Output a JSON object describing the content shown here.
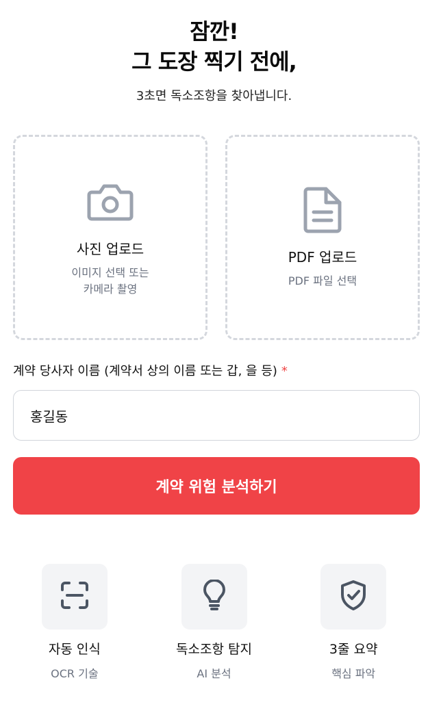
{
  "hero": {
    "title_line1": "잠깐!",
    "title_line2": "그 도장 찍기 전에,",
    "subtitle": "3초면 독소조항을 찾아냅니다."
  },
  "uploads": [
    {
      "title": "사진 업로드",
      "description": "이미지 선택 또는\n카메라 촬영",
      "icon": "camera-icon"
    },
    {
      "title": "PDF 업로드",
      "description": "PDF 파일 선택",
      "icon": "document-icon"
    }
  ],
  "form": {
    "label": "계약 당사자 이름 (계약서 상의 이름 또는 갑, 을 등)",
    "required_mark": "*",
    "name_value": "홍길동"
  },
  "analyze_button": {
    "label": "계약 위험 분석하기"
  },
  "features": [
    {
      "title": "자동 인식",
      "subtitle": "OCR 기술",
      "icon": "scan-icon"
    },
    {
      "title": "독소조항 탐지",
      "subtitle": "AI 분석",
      "icon": "lightbulb-icon"
    },
    {
      "title": "3줄 요약",
      "subtitle": "핵심 파악",
      "icon": "shield-check-icon"
    }
  ],
  "colors": {
    "accent": "#f04347",
    "icon_gray": "#9ca3af",
    "feature_icon": "#4b5563",
    "muted_text": "#6b7280"
  }
}
